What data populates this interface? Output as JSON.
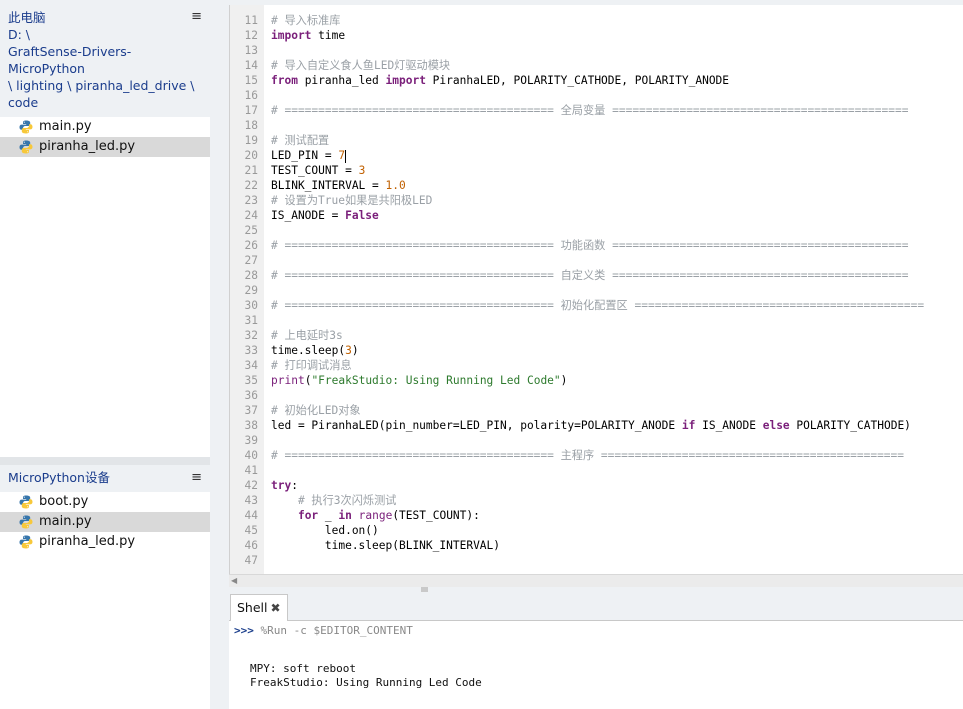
{
  "files_panel": {
    "heading": "此电脑",
    "path_lines": [
      "D: \\",
      "GraftSense-Drivers-MicroPython",
      "\\ lighting \\ piranha_led_drive \\",
      "code"
    ],
    "menu_icon": "hamburger-icon",
    "files": [
      {
        "name": "main.py",
        "selected": false
      },
      {
        "name": "piranha_led.py",
        "selected": true
      }
    ]
  },
  "device_panel": {
    "heading": "MicroPython设备",
    "menu_icon": "hamburger-icon",
    "files": [
      {
        "name": "boot.py",
        "selected": false
      },
      {
        "name": "main.py",
        "selected": true
      },
      {
        "name": "piranha_led.py",
        "selected": false
      }
    ]
  },
  "editor": {
    "lines": [
      {
        "n": "11",
        "text": "# 导入标准库"
      },
      {
        "n": "12",
        "text": "import time"
      },
      {
        "n": "13",
        "text": ""
      },
      {
        "n": "14",
        "text": "# 导入自定义食人鱼LED灯驱动模块"
      },
      {
        "n": "15",
        "text": "from piranha_led import PiranhaLED, POLARITY_CATHODE, POLARITY_ANODE"
      },
      {
        "n": "16",
        "text": ""
      },
      {
        "n": "17",
        "text": "# ======================================== 全局变量 ============================================"
      },
      {
        "n": "18",
        "text": ""
      },
      {
        "n": "19",
        "text": "# 测试配置"
      },
      {
        "n": "20",
        "text": "LED_PIN = 7"
      },
      {
        "n": "21",
        "text": "TEST_COUNT = 3"
      },
      {
        "n": "22",
        "text": "BLINK_INTERVAL = 1.0"
      },
      {
        "n": "23",
        "text": "# 设置为True如果是共阳极LED"
      },
      {
        "n": "24",
        "text": "IS_ANODE = False"
      },
      {
        "n": "25",
        "text": ""
      },
      {
        "n": "26",
        "text": "# ======================================== 功能函数 ============================================"
      },
      {
        "n": "27",
        "text": ""
      },
      {
        "n": "28",
        "text": "# ======================================== 自定义类 ============================================"
      },
      {
        "n": "29",
        "text": ""
      },
      {
        "n": "30",
        "text": "# ======================================== 初始化配置区 ==========================================="
      },
      {
        "n": "31",
        "text": ""
      },
      {
        "n": "32",
        "text": "# 上电延时3s"
      },
      {
        "n": "33",
        "text": "time.sleep(3)"
      },
      {
        "n": "34",
        "text": "# 打印调试消息"
      },
      {
        "n": "35",
        "text": "print(\"FreakStudio: Using Running Led Code\")"
      },
      {
        "n": "36",
        "text": ""
      },
      {
        "n": "37",
        "text": "# 初始化LED对象"
      },
      {
        "n": "38",
        "text": "led = PiranhaLED(pin_number=LED_PIN, polarity=POLARITY_ANODE if IS_ANODE else POLARITY_CATHODE)"
      },
      {
        "n": "39",
        "text": ""
      },
      {
        "n": "40",
        "text": "# ======================================== 主程序 ============================================="
      },
      {
        "n": "41",
        "text": ""
      },
      {
        "n": "42",
        "text": "try:"
      },
      {
        "n": "43",
        "text": "    # 执行3次闪烁测试"
      },
      {
        "n": "44",
        "text": "    for _ in range(TEST_COUNT):"
      },
      {
        "n": "45",
        "text": "        led.on()"
      },
      {
        "n": "46",
        "text": "        time.sleep(BLINK_INTERVAL)"
      },
      {
        "n": "47",
        "text": ""
      }
    ]
  },
  "shell": {
    "tab_label": "Shell",
    "tab_close_icon": "close-icon",
    "prompt": ">>>",
    "command": "%Run -c $EDITOR_CONTENT",
    "output": [
      "MPY: soft reboot",
      "FreakStudio: Using Running Led Code"
    ]
  },
  "colors": {
    "keyword": "#7a1f7a",
    "comment": "#9aa0a6",
    "number": "#c06000",
    "string": "#2d7a2d",
    "panel_heading": "#1a3c8c"
  }
}
